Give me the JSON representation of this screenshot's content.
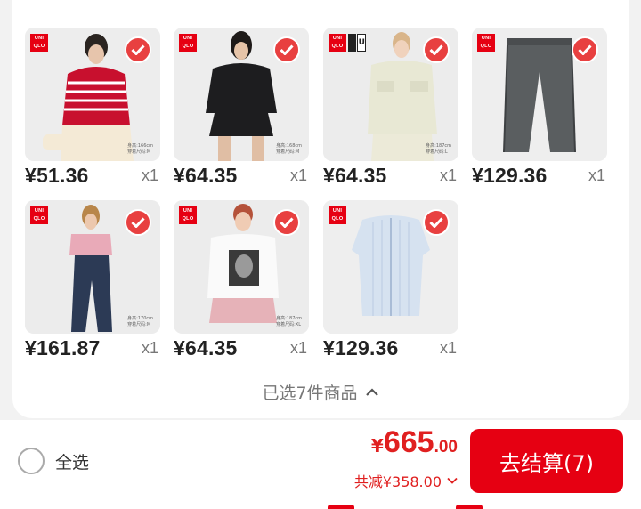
{
  "products": [
    {
      "price": "¥51.36",
      "qty": "x1",
      "image": "model-red-striped-sweater",
      "size_note": "身高:166cm\n穿着尺码:M",
      "badge_icon": "uniqlo-logo"
    },
    {
      "price": "¥64.35",
      "qty": "x1",
      "image": "model-black-jacket-shorts",
      "size_note": "身高:168cm\n穿着尺码:M",
      "badge_icon": "uniqlo-logo"
    },
    {
      "price": "¥64.35",
      "qty": "x1",
      "image": "model-beige-shirt",
      "size_note": "身高:187cm\n穿着尺码:L",
      "badge_icon": "uniqlo-u-logo"
    },
    {
      "price": "¥129.36",
      "qty": "x1",
      "image": "grey-pants",
      "size_note": "",
      "badge_icon": "uniqlo-logo"
    },
    {
      "price": "¥161.87",
      "qty": "x1",
      "image": "model-navy-pants",
      "size_note": "身高:170cm\n穿着尺码:M",
      "badge_icon": "uniqlo-logo"
    },
    {
      "price": "¥64.35",
      "qty": "x1",
      "image": "model-white-tshirt",
      "size_note": "身高:187cm\n穿着尺码:XL",
      "badge_icon": "uniqlo-logo"
    },
    {
      "price": "¥129.36",
      "qty": "x1",
      "image": "blue-striped-shirt",
      "size_note": "",
      "badge_icon": "uniqlo-logo"
    }
  ],
  "brand": {
    "logo_line1": "UNI",
    "logo_line2": "QLO",
    "u_letter": "U"
  },
  "summary": {
    "selected_text": "已选7件商品"
  },
  "footer": {
    "select_all_label": "全选",
    "total_currency": "¥",
    "total_integer": "665",
    "total_decimal": ".00",
    "discount_text": "共减¥358.00",
    "checkout_label": "去结算(7)"
  },
  "colors": {
    "accent": "#e60012",
    "check": "#e84040",
    "price_red": "#e02020"
  }
}
